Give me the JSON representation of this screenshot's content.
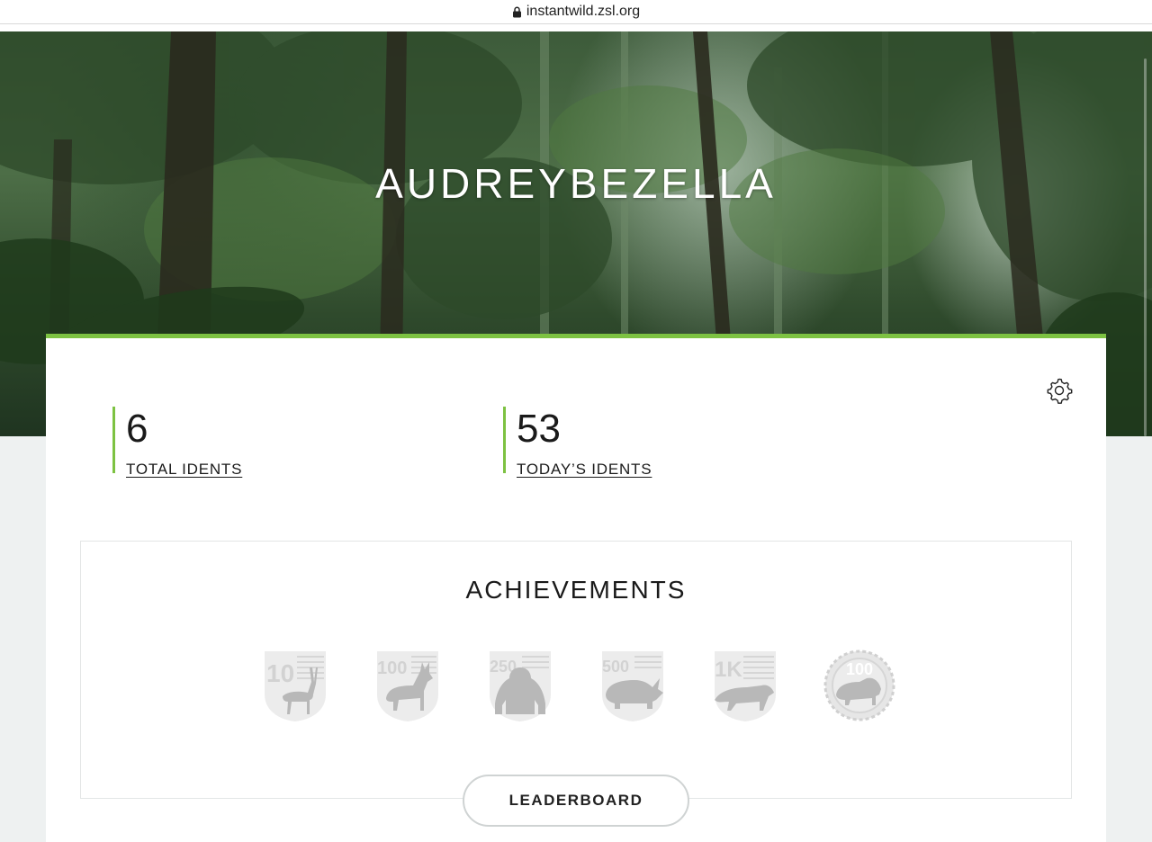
{
  "browser": {
    "url": "instantwild.zsl.org"
  },
  "profile": {
    "username": "AUDREYBEZELLA"
  },
  "stats": {
    "total": {
      "value": "6",
      "label": "TOTAL IDENTS"
    },
    "today": {
      "value": "53",
      "label": "TODAY’S IDENTS"
    }
  },
  "achievements": {
    "title": "ACHIEVEMENTS",
    "badges": [
      {
        "number": "10",
        "animal": "antelope-icon",
        "shape": "shield"
      },
      {
        "number": "100",
        "animal": "wolf-icon",
        "shape": "shield"
      },
      {
        "number": "250",
        "animal": "gorilla-icon",
        "shape": "shield"
      },
      {
        "number": "500",
        "animal": "rhino-icon",
        "shape": "shield"
      },
      {
        "number": "1K",
        "animal": "tiger-icon",
        "shape": "shield"
      },
      {
        "number": "100",
        "animal": "lion-icon",
        "shape": "seal"
      }
    ]
  },
  "leaderboard_button": "LEADERBOARD",
  "colors": {
    "accent": "#7dc242",
    "badge_locked": "#c8c8c8",
    "page_bg": "#eef1f1"
  }
}
